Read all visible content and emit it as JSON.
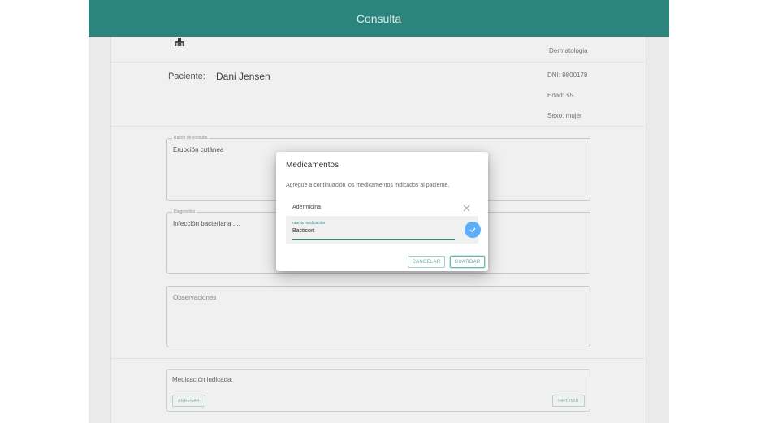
{
  "header": {
    "title": "Consulta"
  },
  "consultation": {
    "specialty": "Dermatologia",
    "patient_label": "Paciente:",
    "patient_name": "Dani Jensen",
    "dni": "DNI: 9800178",
    "age": "Edad: 55",
    "sex": "Sexo: mujer"
  },
  "fields": {
    "reason": {
      "legend": "Razón de consulta",
      "value": "Erupción cutánea"
    },
    "diagnosis": {
      "legend": "Diagnóstico",
      "value": "Infección bacteriana ...."
    },
    "observations": {
      "placeholder": "Observaciones"
    }
  },
  "medication": {
    "label": "Medicación indicada:",
    "add_button": "AGREGAR",
    "print_button": "IMPRIMIR"
  },
  "dialog": {
    "title": "Medicamentos",
    "instructions": "Agregue a continuación los medicamentos indicados al paciente.",
    "items": [
      {
        "label": "Adermicina"
      }
    ],
    "new_med_label": "nueva medicación",
    "new_med_value": "Bacticort",
    "cancel_label": "CANCELAR",
    "save_label": "GUARDAR"
  },
  "colors": {
    "header_bg": "#2d8a80",
    "accent": "#2d8a80",
    "confirm_button": "#5aaefa"
  },
  "icons": {
    "logo": "medical-logo-icon",
    "remove": "close-icon",
    "confirm": "check-icon"
  }
}
